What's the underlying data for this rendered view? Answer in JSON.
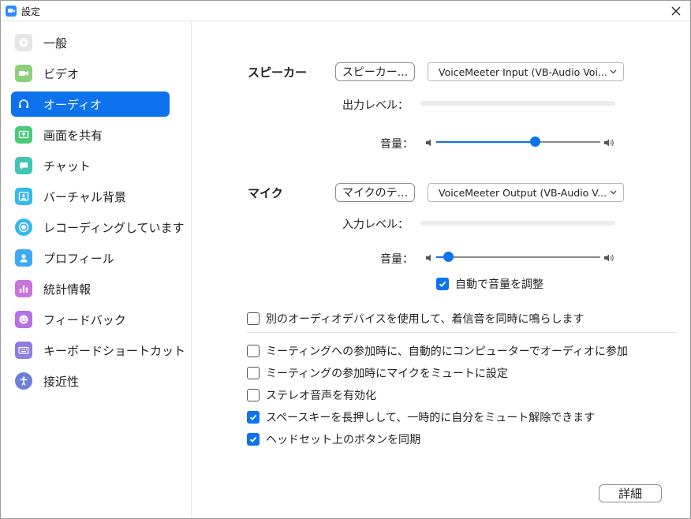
{
  "window": {
    "title": "設定",
    "close_icon": "close-icon"
  },
  "sidebar": {
    "items": [
      {
        "label": "一般",
        "icon": "gear-icon",
        "color": "#E6E6E6"
      },
      {
        "label": "ビデオ",
        "icon": "video-camera-icon",
        "color": "#8BD17C"
      },
      {
        "label": "オーディオ",
        "icon": "headphones-icon",
        "color": "#0E72ED",
        "active": true
      },
      {
        "label": "画面を共有",
        "icon": "share-screen-icon",
        "color": "#4CC97A"
      },
      {
        "label": "チャット",
        "icon": "chat-bubble-icon",
        "color": "#40C6B1"
      },
      {
        "label": "バーチャル背景",
        "icon": "virtual-background-icon",
        "color": "#35B9E8"
      },
      {
        "label": "レコーディングしています",
        "icon": "record-icon",
        "color": "#35B9E8"
      },
      {
        "label": "プロフィール",
        "icon": "profile-icon",
        "color": "#3FA9F5"
      },
      {
        "label": "統計情報",
        "icon": "statistics-icon",
        "color": "#C874D9"
      },
      {
        "label": "フィードバック",
        "icon": "feedback-smile-icon",
        "color": "#B870E6"
      },
      {
        "label": "キーボードショートカット",
        "icon": "keyboard-icon",
        "color": "#8E7CE0"
      },
      {
        "label": "接近性",
        "icon": "accessibility-icon",
        "color": "#6B7FD7"
      }
    ]
  },
  "speaker": {
    "section_label": "スピーカー",
    "test_button": "スピーカー...",
    "device": "VoiceMeeter Input (VB-Audio Voi...",
    "level_label": "出力レベル：",
    "volume_label": "音量：",
    "volume": 0.6
  },
  "mic": {
    "section_label": "マイク",
    "test_button": "マイクのテ...",
    "device": "VoiceMeeter Output (VB-Audio V...",
    "level_label": "入力レベル：",
    "volume_label": "音量：",
    "volume": 0.07,
    "auto_adjust_label": "自動で音量を調整",
    "auto_adjust": true
  },
  "options": {
    "separate_ringtone": {
      "label": "別のオーディオデバイスを使用して、着信音を同時に鳴らします",
      "checked": false
    },
    "auto_join_audio": {
      "label": "ミーティングへの参加時に、自動的にコンピューターでオーディオに参加",
      "checked": false
    },
    "mute_on_join": {
      "label": "ミーティングの参加時にマイクをミュートに設定",
      "checked": false
    },
    "stereo": {
      "label": "ステレオ音声を有効化",
      "checked": false
    },
    "push_to_talk": {
      "label": "スペースキーを長押しして、一時的に自分をミュート解除できます",
      "checked": true
    },
    "headset_sync": {
      "label": "ヘッドセット上のボタンを同期",
      "checked": true
    }
  },
  "advanced_button": "詳細",
  "colors": {
    "accent": "#0E72ED"
  }
}
